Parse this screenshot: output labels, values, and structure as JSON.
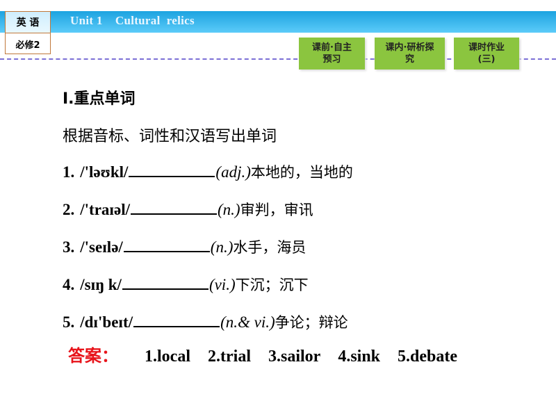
{
  "header": {
    "subject": "英 语",
    "book": "必修2",
    "unit_title": "Unit 1    Cultural  relics"
  },
  "nav": [
    {
      "line1": "课前·自主",
      "line2": "预习"
    },
    {
      "line1": "课内·研析探",
      "line2": "究"
    },
    {
      "line1": "课时作业",
      "line2": "(三)"
    }
  ],
  "section": {
    "heading": "Ⅰ.重点单词",
    "instruction": "根据音标、词性和汉语写出单词"
  },
  "items": [
    {
      "num": "1.",
      "phonetic": "/'ləʊkl/",
      "pos": "(adj.)",
      "meaning": "本地的，当地的"
    },
    {
      "num": "2.",
      "phonetic": "/'traɪəl/",
      "pos": "(n.)",
      "meaning": "审判，审讯"
    },
    {
      "num": "3.",
      "phonetic": "/'seɪlə/",
      "pos": "(n.)",
      "meaning": "水手，海员"
    },
    {
      "num": "4.",
      "phonetic": "/sɪŋ k/",
      "pos": "(vi.)",
      "meaning": "下沉；沉下"
    },
    {
      "num": "5.",
      "phonetic": "/dɪ'beɪt/",
      "pos": "(n.& vi.)",
      "meaning": "争论；辩论"
    }
  ],
  "answer": {
    "label": "答案：",
    "values": [
      "1.local",
      "2.trial",
      "3.sailor",
      "4.sink",
      "5.debate"
    ]
  }
}
